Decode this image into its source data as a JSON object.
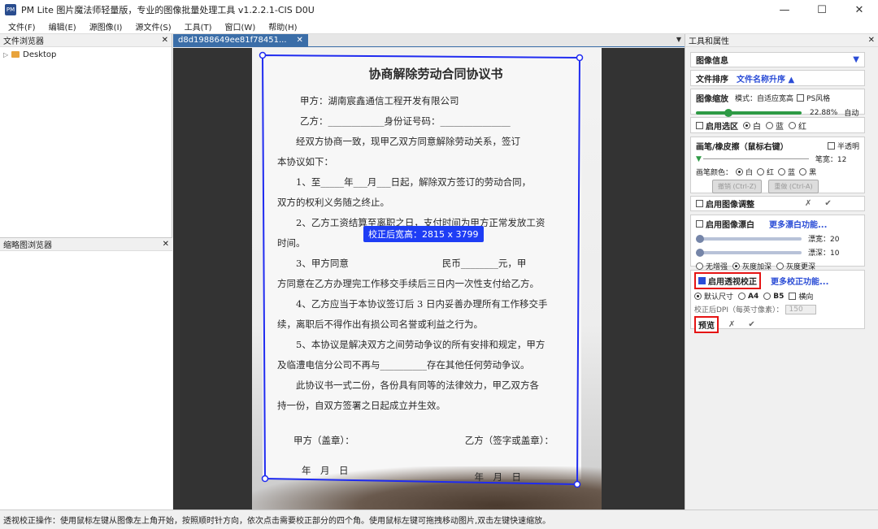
{
  "window": {
    "title": "PM Lite 图片魔法师轻量版，专业的图像批量处理工具 v1.2.2.1-CIS D0U",
    "minimize": "—",
    "maximize": "☐",
    "close": "✕"
  },
  "menu": [
    "文件(F)",
    "编辑(E)",
    "源图像(I)",
    "源文件(S)",
    "工具(T)",
    "窗口(W)",
    "帮助(H)"
  ],
  "left_panel": {
    "title": "文件浏览器",
    "close": "✕",
    "tree_item": "Desktop",
    "thumb_title": "缩略图浏览器",
    "thumb_close": "✕"
  },
  "center": {
    "tab_label": "d8d1988649ee81f78451...",
    "tab_close": "✕",
    "tab_menu": "▼",
    "overlay_text": "校正后宽高：2815 x 3799"
  },
  "document": {
    "title": "协商解除劳动合同协议书",
    "lines": [
      "甲方：湖南宸鑫通信工程开发有限公司",
      "乙方：____________身份证号码：_______________",
      "　　经双方协商一致，现甲乙双方同意解除劳动关系，签订",
      "本协议如下：",
      "　　1、至_____年___月___日起，解除双方签订的劳动合同，",
      "双方的权利义务随之终止。",
      "　　2、乙方工资结算至离职之日，支付时间为甲方正常发放工资",
      "时间。",
      "　　3、甲方同意　　　　　　　　　　民币________元，甲",
      "方同意在乙方办理完工作移交手续后三日内一次性支付给乙方。",
      "　　4、乙方应当于本协议签订后 3 日内妥善办理所有工作移交手",
      "续，离职后不得作出有损公司名誉或利益之行为。",
      "　　5、本协议是解决双方之间劳动争议的所有安排和规定，甲方",
      "及临澧电信分公司不再与__________存在其他任何劳动争议。",
      "　　此协议书一式二份，各份具有同等的法律效力，甲乙双方各",
      "持一份，自双方签署之日起成立并生效。"
    ],
    "party_a_sign": "甲方（盖章）：",
    "party_b_sign": "乙方（签字或盖章）：",
    "date_a": "年　月　日",
    "date_b": "年　月　日"
  },
  "right_panel": {
    "title": "工具和属性",
    "close": "✕",
    "image_info": "图像信息",
    "image_info_arrow": "▼",
    "sort_label": "文件排序",
    "sort_value": "文件名称升序 ▲",
    "zoom": {
      "label": "图像缩放",
      "mode": "模式：自适应宽高",
      "ps_style": "PS风格",
      "percent": "22.88%",
      "auto": "自动",
      "level": 0.3
    },
    "selection": {
      "label": "启用选区",
      "white": "白",
      "blue": "蓝",
      "red": "红"
    },
    "brush": {
      "label": "画笔/橡皮擦（鼠标右键）",
      "semi": "半透明",
      "width_label": "笔宽：12",
      "color_label": "画笔颜色：",
      "white": "白",
      "red": "红",
      "blue": "蓝",
      "black": "黑",
      "undo": "撤销 (Ctrl-Z)",
      "redo": "重做 (Ctrl-A)"
    },
    "adjust": {
      "label": "启用图像调整",
      "cancel": "✗",
      "ok": "✔"
    },
    "whiten": {
      "label": "启用图像漂白",
      "more": "更多漂白功能...",
      "width_label": "漂宽：20",
      "depth_label": "漂深：10",
      "opt1": "无增强",
      "opt2": "灰度加深",
      "opt3": "灰度更深"
    },
    "perspective": {
      "label": "启用透视校正",
      "more": "更多校正功能...",
      "default_size": "默认尺寸",
      "a4": "A4",
      "b5": "B5",
      "landscape": "横向",
      "dpi_label": "校正后DPI（每英寸像素）：",
      "dpi_value": "150",
      "preview": "预览",
      "cancel": "✗",
      "ok": "✔"
    }
  },
  "statusbar": "透视校正操作：使用鼠标左键从图像左上角开始，按照顺时针方向，依次点击需要校正部分的四个角。使用鼠标左键可拖拽移动图片,双击左键快速缩放。"
}
